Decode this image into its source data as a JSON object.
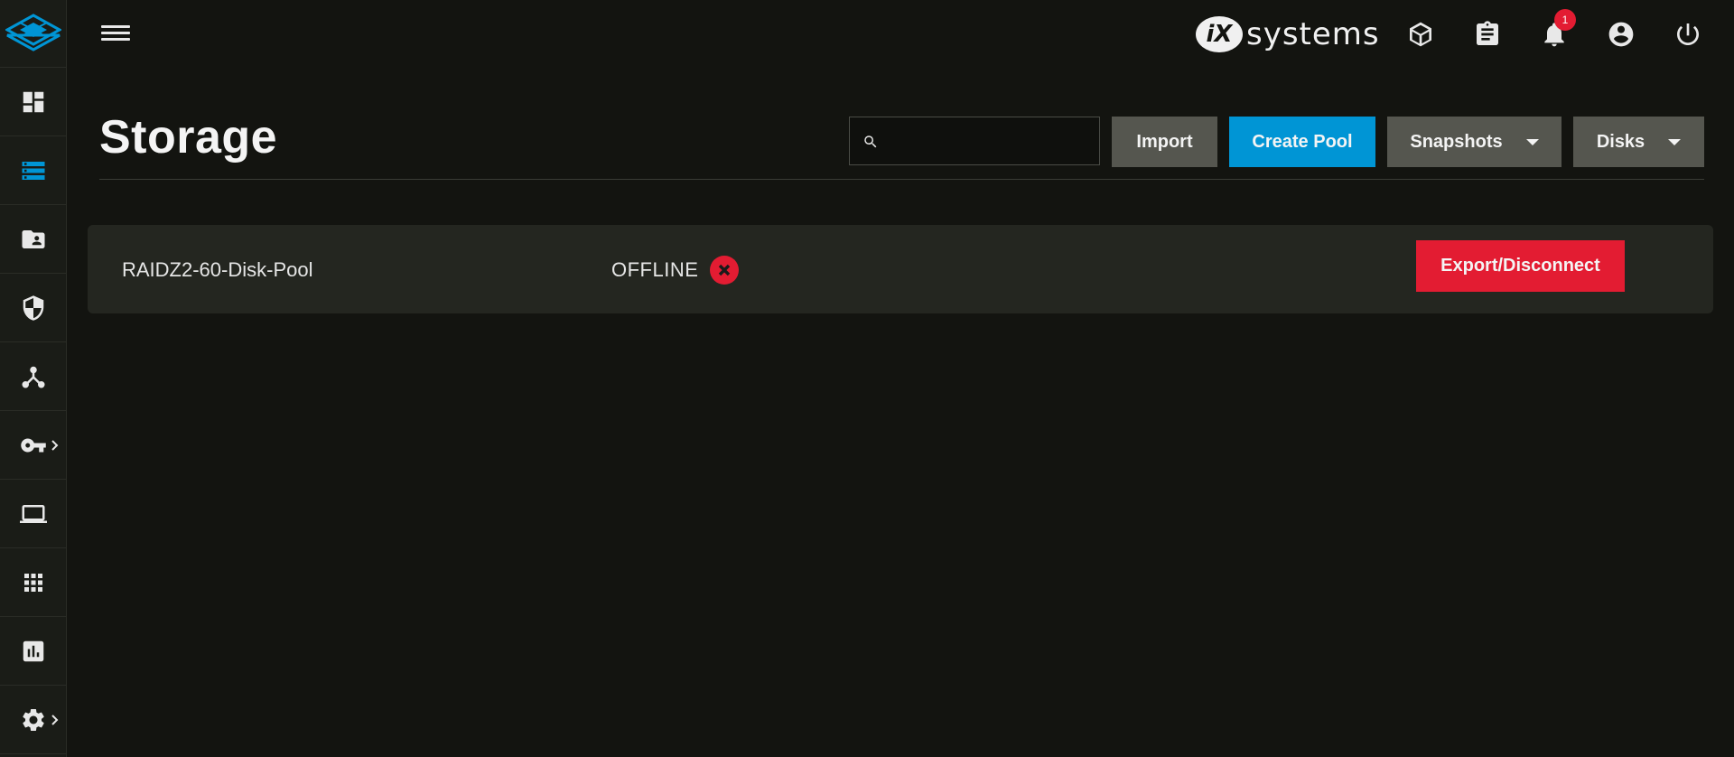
{
  "sidebar": {
    "logo": "truenas-logo-icon",
    "items": [
      {
        "name": "dashboard",
        "icon": "dashboard-icon"
      },
      {
        "name": "storage",
        "icon": "storage-icon",
        "active": true
      },
      {
        "name": "sharing",
        "icon": "folder-shared-icon"
      },
      {
        "name": "network-security",
        "icon": "security-shield-icon"
      },
      {
        "name": "network",
        "icon": "network-icon"
      },
      {
        "name": "credentials",
        "icon": "key-icon",
        "has_submenu": true
      },
      {
        "name": "virtual-machines",
        "icon": "laptop-icon"
      },
      {
        "name": "apps",
        "icon": "apps-grid-icon"
      },
      {
        "name": "reporting",
        "icon": "reporting-chart-icon"
      },
      {
        "name": "system-settings",
        "icon": "gear-icon",
        "has_submenu": true
      }
    ],
    "accent_color": "#0095d5"
  },
  "topbar": {
    "brand_mark": "iX",
    "brand_text": "systems",
    "notifications_count": "1"
  },
  "page": {
    "title": "Storage",
    "search_placeholder": ""
  },
  "toolbar": {
    "import_label": "Import",
    "create_pool_label": "Create Pool",
    "snapshots_label": "Snapshots",
    "disks_label": "Disks"
  },
  "pools": [
    {
      "name": "RAIDZ2-60-Disk-Pool",
      "status": "OFFLINE",
      "status_color": "#e31c32",
      "action_label": "Export/Disconnect"
    }
  ],
  "colors": {
    "background": "#131410",
    "primary": "#0095d5",
    "danger": "#e31c32",
    "button_grey": "#55564f"
  }
}
